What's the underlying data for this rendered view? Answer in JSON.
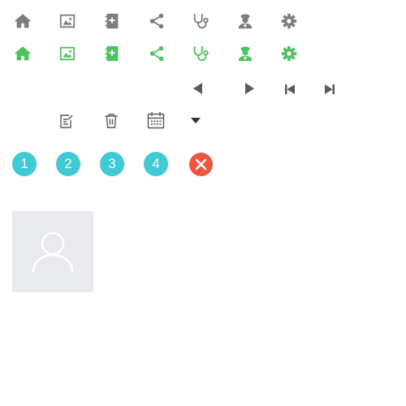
{
  "icons": {
    "row1": [
      "home-icon",
      "image-icon",
      "contacts-book-icon",
      "share-icon",
      "stethoscope-icon",
      "doctor-icon",
      "gear-icon"
    ],
    "row2": [
      "home-icon",
      "image-icon",
      "contacts-book-icon",
      "share-icon",
      "stethoscope-icon",
      "doctor-icon",
      "gear-icon"
    ],
    "media": [
      "triangle-left-icon",
      "triangle-right-icon",
      "skip-first-icon",
      "skip-last-icon"
    ],
    "tools": [
      "edit-icon",
      "trash-icon",
      "calendar-icon",
      "caret-down-icon"
    ],
    "close": "close-icon",
    "avatar": "user-silhouette-icon"
  },
  "steps": [
    "1",
    "2",
    "3",
    "4"
  ],
  "colors": {
    "icon_gray": "#7d7d7d",
    "icon_green": "#4fc25f",
    "icon_dark": "#5a5a5a",
    "step_teal": "#3fcbd6",
    "close_red": "#f25442",
    "avatar_bg": "#e8eaed",
    "avatar_fg": "#ffffff"
  }
}
